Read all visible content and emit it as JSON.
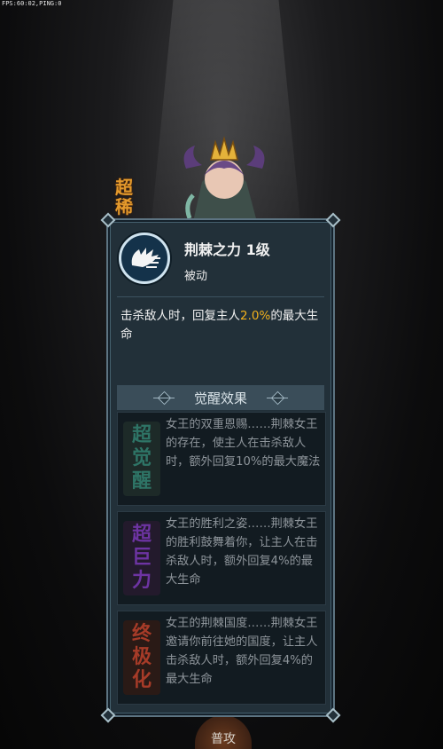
{
  "debug": {
    "fps_text": "FPS:60:02,PING:0"
  },
  "background": {
    "side_tag": "超稀",
    "bottom_button": "普攻"
  },
  "skill": {
    "icon": "thorn-power-icon",
    "name": "荆棘之力 1级",
    "type": "被动",
    "description_before": "击杀敌人时，回复主人",
    "description_highlight": "2.0%",
    "description_after": "的最大生命",
    "highlight_color": "#f2b11c"
  },
  "awaken": {
    "title": "觉醒效果",
    "items": [
      {
        "badge": [
          "超",
          "觉",
          "醒"
        ],
        "badge_color": "#3f8a7d",
        "text": "女王的双重恩赐……荆棘女王的存在，使主人在击杀敌人时，额外回复10%的最大魔法"
      },
      {
        "badge": [
          "超",
          "巨",
          "力"
        ],
        "badge_color": "#7b3fb0",
        "text": "女王的胜利之姿……荆棘女王的胜利鼓舞着你，让主人在击杀敌人时，额外回复4%的最大生命"
      },
      {
        "badge": [
          "终",
          "极",
          "化"
        ],
        "badge_color": "#b3402c",
        "text": "女王的荆棘国度……荆棘女王邀请你前往她的国度，让主人击杀敌人时，额外回复4%的最大生命"
      }
    ]
  }
}
